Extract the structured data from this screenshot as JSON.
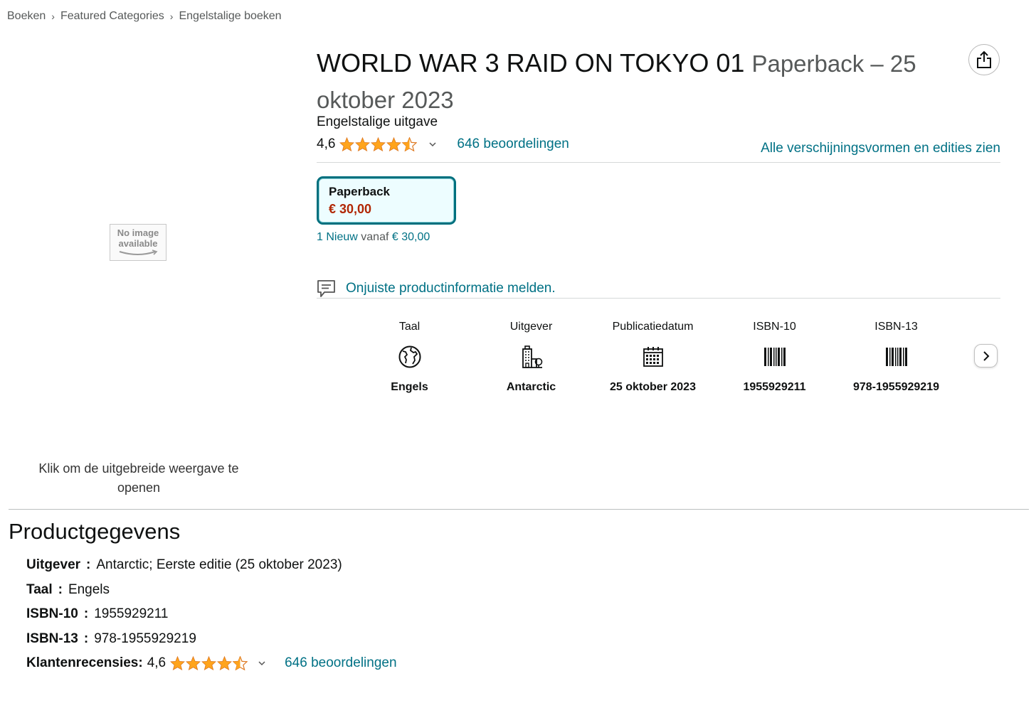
{
  "breadcrumb": [
    "Boeken",
    "Featured Categories",
    "Engelstalige boeken"
  ],
  "breadcrumb_separator": "›",
  "image": {
    "placeholder_line1": "No image",
    "placeholder_line2": "available",
    "caption": "Klik om de uitgebreide weergave te openen"
  },
  "product": {
    "title": "WORLD WAR 3 RAID ON TOKYO 01",
    "subtitle": "Paperback – 25 oktober 2023",
    "edition": "Engelstalige uitgave",
    "rating_value": "4,6",
    "rating_stars": 4.5,
    "ratings_count": "646 beoordelingen",
    "all_formats_link": "Alle verschijningsvormen en edities zien"
  },
  "format": {
    "name": "Paperback",
    "price": "€ 30,00",
    "offers_new": "1 Nieuw",
    "offers_from": "vanaf",
    "offers_price": "€ 30,00"
  },
  "report_link": "Onjuiste productinformatie melden.",
  "attributes": [
    {
      "label": "Taal",
      "icon": "globe-icon",
      "value": "Engels"
    },
    {
      "label": "Uitgever",
      "icon": "building-icon",
      "value": "Antarctic"
    },
    {
      "label": "Publicatiedatum",
      "icon": "calendar-icon",
      "value": "25 oktober 2023"
    },
    {
      "label": "ISBN-10",
      "icon": "barcode-icon",
      "value": "1955929211"
    },
    {
      "label": "ISBN-13",
      "icon": "barcode-icon",
      "value": "978-1955929219"
    }
  ],
  "details": {
    "title": "Productgegevens",
    "rows": [
      {
        "key": "Uitgever",
        "value": "Antarctic; Eerste editie (25 oktober 2023)"
      },
      {
        "key": "Taal",
        "value": "Engels"
      },
      {
        "key": "ISBN-10",
        "value": "1955929211"
      },
      {
        "key": "ISBN-13",
        "value": "978-1955929219"
      }
    ],
    "reviews_key": "Klantenrecensies:",
    "reviews_value": "4,6",
    "reviews_count": "646 beoordelingen"
  },
  "colors": {
    "link": "#007185",
    "price": "#B12704",
    "star": "#FFA41C",
    "selected_border": "#00707e"
  }
}
